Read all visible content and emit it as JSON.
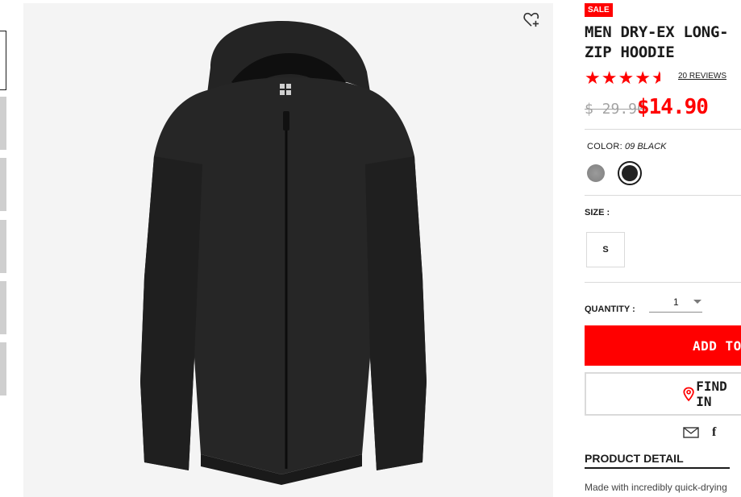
{
  "product": {
    "sale_badge": "SALE",
    "title": "MEN DRY-EX LONG-\nZIP HOODIE",
    "rating_stars": 4.5,
    "reviews_label": "20 REVIEWS",
    "price_old": "$ 29.90",
    "price_new": "$14.90"
  },
  "options": {
    "color_label": "COLOR:",
    "color_value": "09 BLACK",
    "size_label": "SIZE :",
    "size_selected": "S",
    "quantity_label": "QUANTITY :",
    "quantity_value": "1"
  },
  "actions": {
    "add_to_cart": "ADD TO",
    "find_in_store": "FIND IN"
  },
  "detail": {
    "title": "PRODUCT DETAIL",
    "text": "Made with incredibly quick-drying"
  },
  "colors": {
    "accent": "#ff0000",
    "text": "#1b1b1b",
    "muted": "#a3a3a3",
    "border": "#dadada",
    "image_bg": "#f4f4f4"
  },
  "icons": {
    "wishlist": "heart-plus-icon",
    "star": "star-icon",
    "location": "map-pin-icon",
    "mail": "mail-icon",
    "facebook": "facebook-icon"
  }
}
